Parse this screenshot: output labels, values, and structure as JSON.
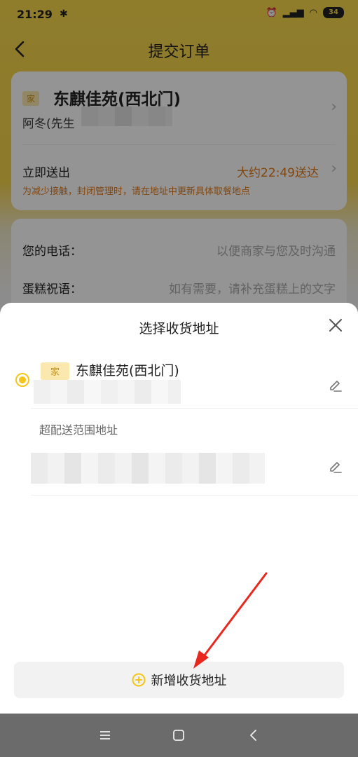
{
  "status_bar": {
    "time": "21:29",
    "battery": "34"
  },
  "nav": {
    "title": "提交订单"
  },
  "order": {
    "address_tag": "家",
    "address": "东麒佳苑(西北门)",
    "contact": "阿冬(先生",
    "deliver_label": "立即送出",
    "deliver_time": "大约22:49送达",
    "deliver_note": "为减少接触，封闭管理时，请在地址中更新具体取餐地点",
    "phone_label": "您的电话：",
    "phone_placeholder": "以便商家与您及时沟通",
    "cake_label": "蛋糕祝语：",
    "cake_placeholder": "如有需要，请补充蛋糕上的文字"
  },
  "sheet": {
    "title": "选择收货地址",
    "addresses": [
      {
        "tag": "家",
        "name": "东麒佳苑(西北门)",
        "selected": true
      }
    ],
    "out_of_range_label": "超配送范围地址",
    "add_label": "新增收货地址"
  },
  "colors": {
    "accent": "#f5c518",
    "orange": "#e07a1a",
    "arrow": "#e8281e"
  }
}
